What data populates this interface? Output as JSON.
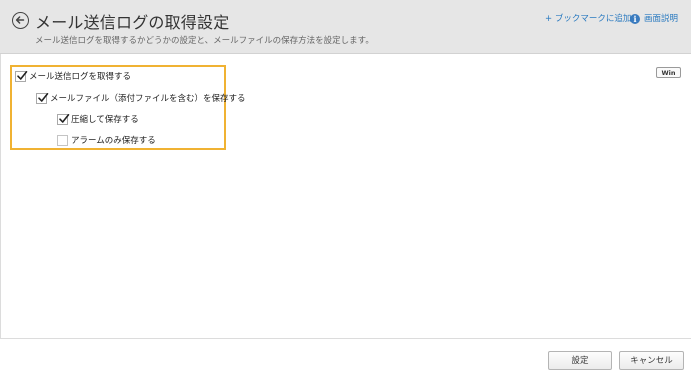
{
  "header": {
    "title": "メール送信ログの取得設定",
    "description": "メール送信ログを取得するかどうかの設定と、メールファイルの保存方法を設定します。",
    "bookmark_label": "+ ブックマークに追加",
    "help_label": "画面説明",
    "help_icon": "info-icon",
    "back_icon": "back-arrow-icon"
  },
  "options": [
    {
      "label": "メール送信ログを取得する",
      "checked": true
    },
    {
      "label": "メールファイル（添付ファイルを含む）を保存する",
      "checked": true
    },
    {
      "label": "圧縮して保存する",
      "checked": true
    },
    {
      "label": "アラームのみ保存する",
      "checked": false
    }
  ],
  "os_badge": "Win",
  "footer": {
    "save_label": "設定",
    "cancel_label": "キャンセル"
  },
  "colors": {
    "highlight_border": "#f0b232",
    "link": "#2a7ac0",
    "header_bg": "#e6e6e6"
  }
}
